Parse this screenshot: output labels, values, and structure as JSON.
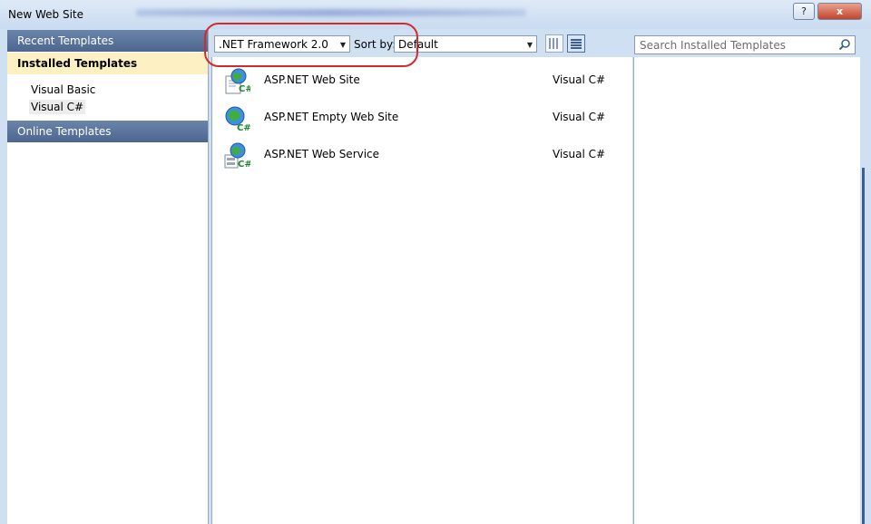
{
  "window": {
    "title": "New Web Site",
    "help_label": "?",
    "close_label": "x"
  },
  "sidebar": {
    "recent": "Recent Templates",
    "installed": "Installed Templates",
    "items": [
      "Visual Basic",
      "Visual C#"
    ],
    "online": "Online Templates"
  },
  "toolbar": {
    "framework_value": ".NET Framework 2.0",
    "sort_label": "Sort by:",
    "sort_value": "Default",
    "view_small_icon": "small-icons-view-icon",
    "view_list_icon": "list-view-icon"
  },
  "templates": [
    {
      "name": "ASP.NET Web Site",
      "language": "Visual C#",
      "icon": "globe-page-csharp-icon"
    },
    {
      "name": "ASP.NET Empty Web Site",
      "language": "Visual C#",
      "icon": "globe-csharp-icon"
    },
    {
      "name": "ASP.NET Web Service",
      "language": "Visual C#",
      "icon": "globe-service-csharp-icon"
    }
  ],
  "search": {
    "placeholder": "Search Installed Templates",
    "icon": "search-icon"
  },
  "colors": {
    "accent_header": "#4c6691",
    "selected_category": "#fdf1c3",
    "annotation_circle": "#d12b2b",
    "frame": "#cfe0f3"
  }
}
